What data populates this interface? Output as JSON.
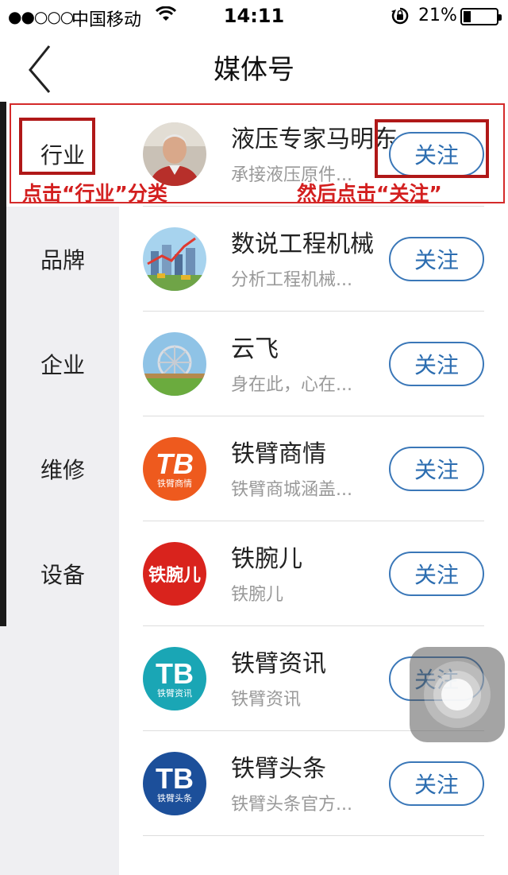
{
  "status_bar": {
    "signal": "●●○○○",
    "carrier": "中国移动",
    "time": "14:11",
    "battery_percent": "21%",
    "battery_level": 0.21
  },
  "nav": {
    "title": "媒体号",
    "back_icon": "chevron-left-icon"
  },
  "sidebar": {
    "items": [
      {
        "label": "行业",
        "active": true
      },
      {
        "label": "品牌",
        "active": false
      },
      {
        "label": "企业",
        "active": false
      },
      {
        "label": "维修",
        "active": false
      },
      {
        "label": "设备",
        "active": false
      }
    ]
  },
  "list": {
    "follow_label": "关注",
    "items": [
      {
        "name": "液压专家马明东",
        "desc": "承接液压原件..."
      },
      {
        "name": "数说工程机械",
        "desc": "分析工程机械..."
      },
      {
        "name": "云飞",
        "desc": "身在此，心在..."
      },
      {
        "name": "铁臂商情",
        "desc": "铁臂商城涵盖...",
        "logo_text": "TB",
        "logo_sub": "铁臂商情"
      },
      {
        "name": "铁腕儿",
        "desc": "铁腕儿",
        "logo_text": "铁腕儿"
      },
      {
        "name": "铁臂资讯",
        "desc": "铁臂资讯",
        "logo_text": "TB",
        "logo_sub": "铁臂资讯"
      },
      {
        "name": "铁臂头条",
        "desc": "铁臂头条官方...",
        "logo_text": "TB",
        "logo_sub": "铁臂头条"
      }
    ]
  },
  "annotations": {
    "left": "点击“行业”分类",
    "right": "然后点击“关注”"
  },
  "colors": {
    "accent": "#2c6db0",
    "annotation_red": "#d31f1f",
    "sidebar_bg": "#efeff2"
  }
}
